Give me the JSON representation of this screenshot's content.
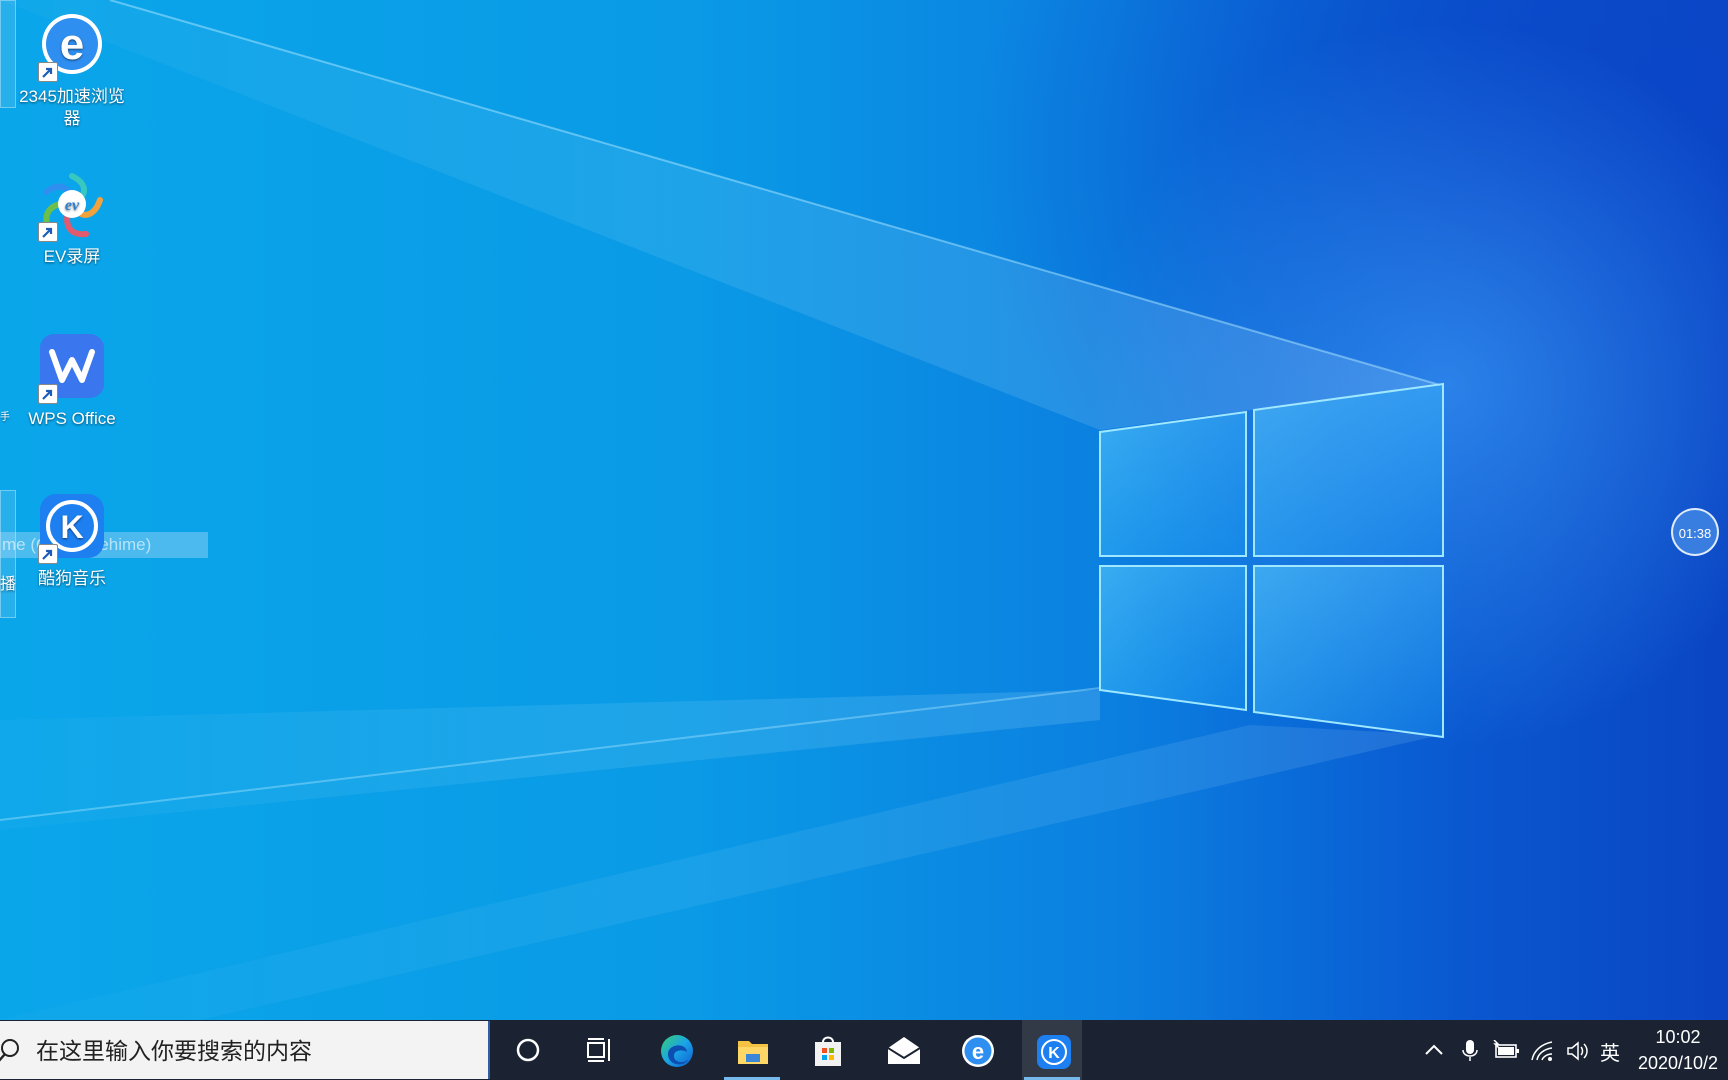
{
  "desktop": {
    "icons": [
      {
        "label": "2345加速浏览器",
        "icon": "ie-browser-icon"
      },
      {
        "label": "EV录屏",
        "icon": "ev-recorder-icon"
      },
      {
        "label": "WPS Office",
        "icon": "wps-icon"
      },
      {
        "label": "酷狗音乐",
        "icon": "kugou-icon"
      }
    ],
    "left_edge_glyph_1": "手",
    "left_edge_glyph_2": "播",
    "tooltip": "me (C:\\bili\\livehime)"
  },
  "timer_bubble": "01:38",
  "taskbar": {
    "search_placeholder": "在这里输入你要搜索的内容",
    "pinned": [
      {
        "name": "cortana",
        "icon": "cortana-circle-icon"
      },
      {
        "name": "task-view",
        "icon": "task-view-icon"
      },
      {
        "name": "edge",
        "icon": "edge-icon"
      },
      {
        "name": "file-explorer",
        "icon": "folder-icon"
      },
      {
        "name": "store",
        "icon": "store-icon"
      },
      {
        "name": "mail",
        "icon": "mail-icon"
      },
      {
        "name": "browser-2345",
        "icon": "ie-browser-icon"
      },
      {
        "name": "kugou",
        "icon": "kugou-icon"
      }
    ],
    "ime": "英",
    "clock_time": "10:02",
    "clock_date": "2020/10/2"
  },
  "colors": {
    "taskbar": "#1b2333",
    "accent": "#76b9ed",
    "desktop_blue": "#0a9ae6"
  }
}
